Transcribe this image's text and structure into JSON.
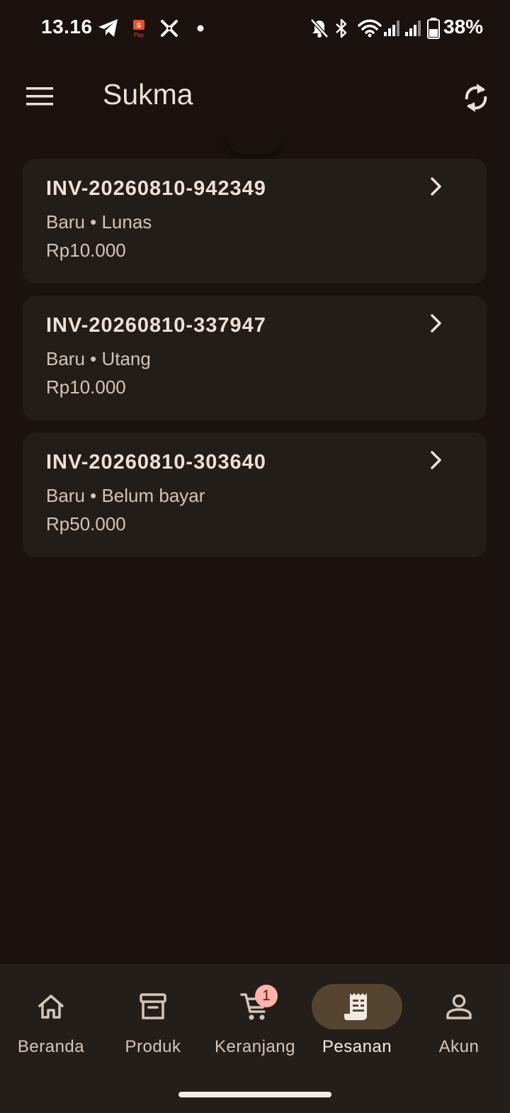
{
  "status_bar": {
    "time": "13.16",
    "battery": "38%",
    "icons": [
      "telegram-icon",
      "shopeepay-icon",
      "x-tool-icon",
      "dot-icon",
      "bell-off-icon",
      "bluetooth-icon",
      "wifi-icon",
      "signal-icon",
      "signal-icon",
      "battery-icon"
    ]
  },
  "app_bar": {
    "title": "Sukma",
    "menu_icon": "menu-icon",
    "refresh_icon": "refresh-icon"
  },
  "orders": [
    {
      "id": "INV-20260810-942349",
      "status": "Baru • Lunas",
      "amount": "Rp10.000"
    },
    {
      "id": "INV-20260810-337947",
      "status": "Baru • Utang",
      "amount": "Rp10.000"
    },
    {
      "id": "INV-20260810-303640",
      "status": "Baru • Belum bayar",
      "amount": "Rp50.000"
    }
  ],
  "bottom_nav": {
    "items": [
      {
        "label": "Beranda",
        "icon": "home-icon",
        "active": false
      },
      {
        "label": "Produk",
        "icon": "archive-icon",
        "active": false
      },
      {
        "label": "Keranjang",
        "icon": "cart-icon",
        "active": false
      },
      {
        "label": "Pesanan",
        "icon": "receipt-icon",
        "active": true
      },
      {
        "label": "Akun",
        "icon": "person-icon",
        "active": false
      }
    ],
    "cart_badge": "1"
  },
  "colors": {
    "background": "#19120e",
    "card": "#231d19",
    "nav_background": "#241e1a",
    "active_pill": "#55442f",
    "badge": "#ffb3ad"
  }
}
